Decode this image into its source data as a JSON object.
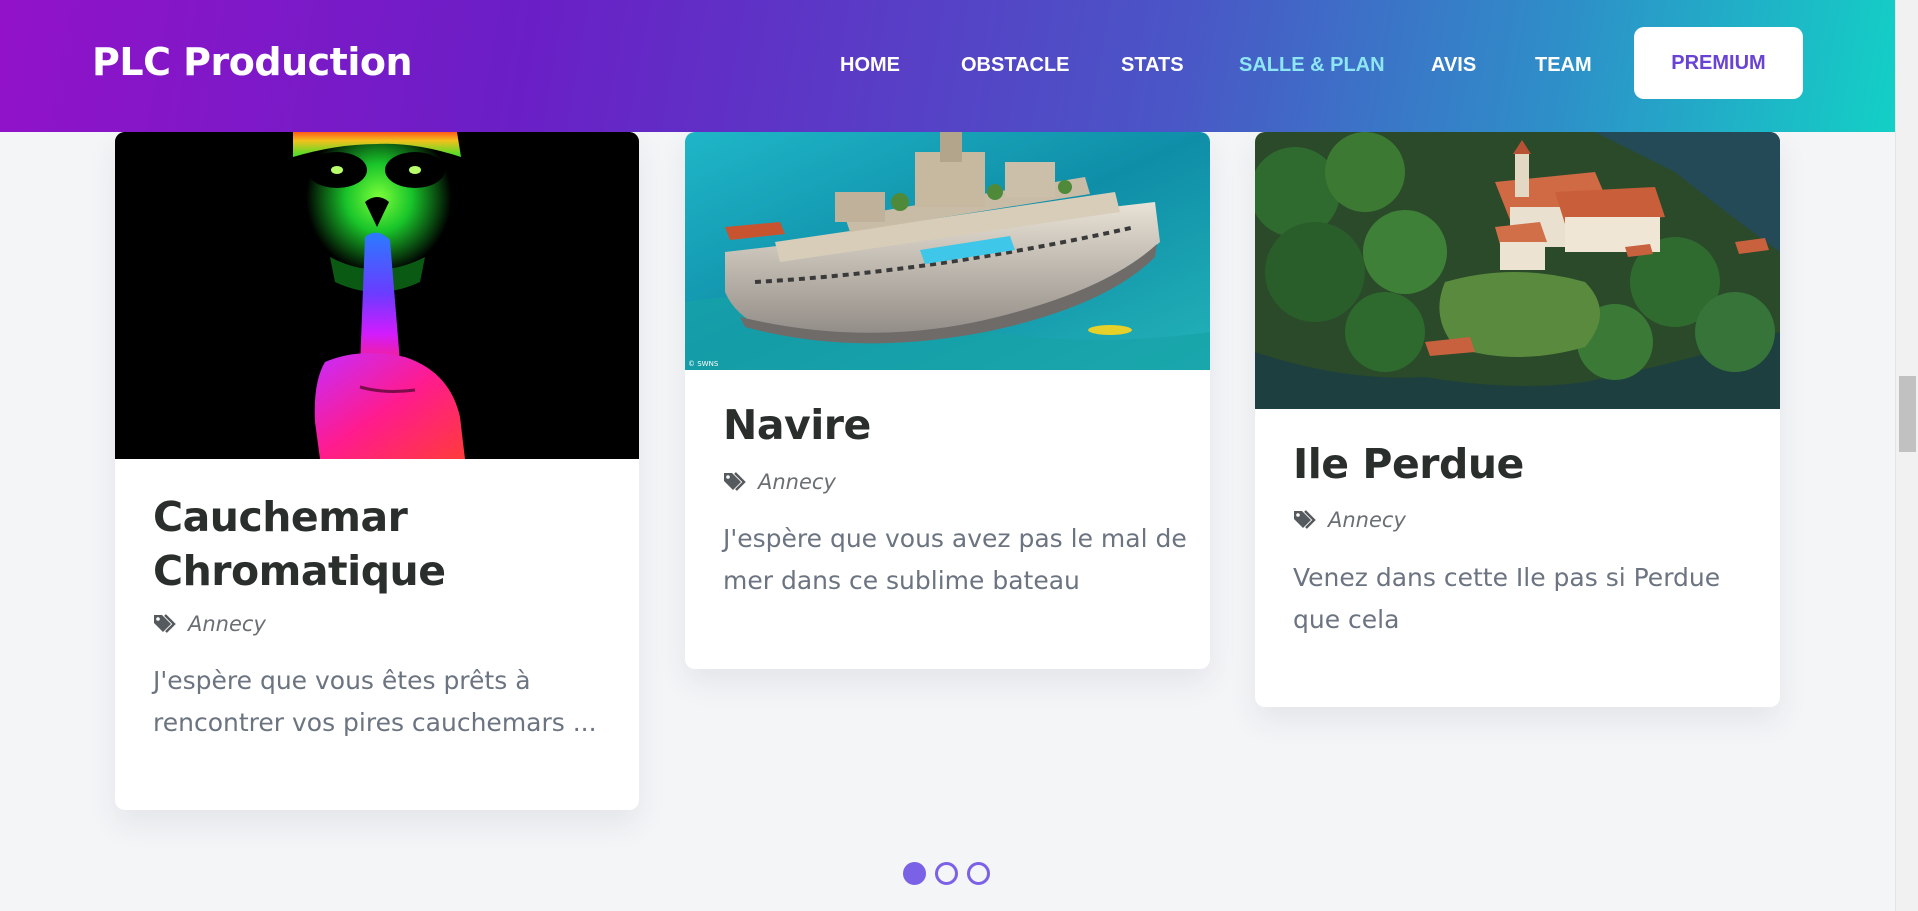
{
  "navbar": {
    "brand": "PLC Production",
    "links": [
      {
        "label": "HOME"
      },
      {
        "label": "OBSTACLE"
      },
      {
        "label": "STATS"
      },
      {
        "label": "SALLE & PLAN"
      },
      {
        "label": "AVIS"
      },
      {
        "label": "TEAM"
      }
    ],
    "active_link": "SALLE & PLAN",
    "premium_label": "PREMIUM"
  },
  "cards": [
    {
      "title": "Cauchemar Chromatique",
      "tag": "Annecy",
      "description": "J'espère que vous êtes prêts à rencontrer vos pires cauchemars ...",
      "image": "neon-skull-finger-on-lips"
    },
    {
      "title": "Navire",
      "tag": "Annecy",
      "description": "J'espère que vous avez pas le mal de mer dans ce sublime bateau",
      "image": "luxury-yacht-at-sea",
      "image_caption": "© SWNS"
    },
    {
      "title": "Ile Perdue",
      "tag": "Annecy",
      "description": "Venez dans cette Ile pas si Perdue que cela",
      "image": "wooded-island-with-red-roofed-buildings"
    }
  ],
  "pagination": {
    "total": 3,
    "active_index": 0
  },
  "colors": {
    "accent": "#7a61e6",
    "active_link": "#8ee6f2",
    "premium_text": "#6a43d4",
    "title_text": "#2b2f2c",
    "body_text": "#6b7480"
  }
}
